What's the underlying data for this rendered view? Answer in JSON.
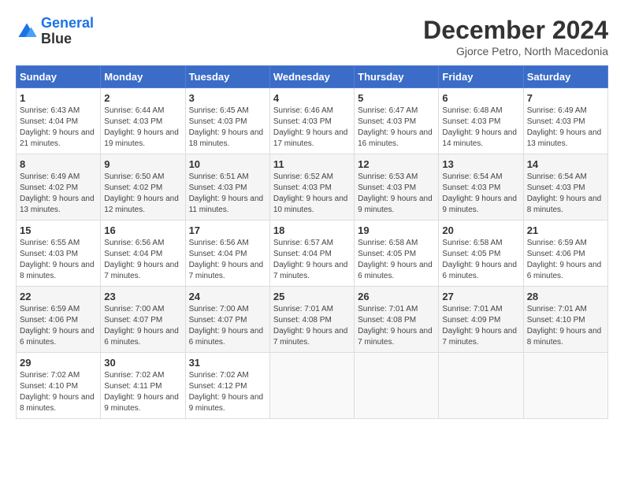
{
  "header": {
    "logo_line1": "General",
    "logo_line2": "Blue",
    "month": "December 2024",
    "location": "Gjorce Petro, North Macedonia"
  },
  "days": [
    "Sunday",
    "Monday",
    "Tuesday",
    "Wednesday",
    "Thursday",
    "Friday",
    "Saturday"
  ],
  "weeks": [
    [
      {
        "num": "1",
        "rise": "6:43 AM",
        "set": "4:04 PM",
        "daylight": "9 hours and 21 minutes."
      },
      {
        "num": "2",
        "rise": "6:44 AM",
        "set": "4:03 PM",
        "daylight": "9 hours and 19 minutes."
      },
      {
        "num": "3",
        "rise": "6:45 AM",
        "set": "4:03 PM",
        "daylight": "9 hours and 18 minutes."
      },
      {
        "num": "4",
        "rise": "6:46 AM",
        "set": "4:03 PM",
        "daylight": "9 hours and 17 minutes."
      },
      {
        "num": "5",
        "rise": "6:47 AM",
        "set": "4:03 PM",
        "daylight": "9 hours and 16 minutes."
      },
      {
        "num": "6",
        "rise": "6:48 AM",
        "set": "4:03 PM",
        "daylight": "9 hours and 14 minutes."
      },
      {
        "num": "7",
        "rise": "6:49 AM",
        "set": "4:03 PM",
        "daylight": "9 hours and 13 minutes."
      }
    ],
    [
      {
        "num": "8",
        "rise": "6:49 AM",
        "set": "4:02 PM",
        "daylight": "9 hours and 13 minutes."
      },
      {
        "num": "9",
        "rise": "6:50 AM",
        "set": "4:02 PM",
        "daylight": "9 hours and 12 minutes."
      },
      {
        "num": "10",
        "rise": "6:51 AM",
        "set": "4:03 PM",
        "daylight": "9 hours and 11 minutes."
      },
      {
        "num": "11",
        "rise": "6:52 AM",
        "set": "4:03 PM",
        "daylight": "9 hours and 10 minutes."
      },
      {
        "num": "12",
        "rise": "6:53 AM",
        "set": "4:03 PM",
        "daylight": "9 hours and 9 minutes."
      },
      {
        "num": "13",
        "rise": "6:54 AM",
        "set": "4:03 PM",
        "daylight": "9 hours and 9 minutes."
      },
      {
        "num": "14",
        "rise": "6:54 AM",
        "set": "4:03 PM",
        "daylight": "9 hours and 8 minutes."
      }
    ],
    [
      {
        "num": "15",
        "rise": "6:55 AM",
        "set": "4:03 PM",
        "daylight": "9 hours and 8 minutes."
      },
      {
        "num": "16",
        "rise": "6:56 AM",
        "set": "4:04 PM",
        "daylight": "9 hours and 7 minutes."
      },
      {
        "num": "17",
        "rise": "6:56 AM",
        "set": "4:04 PM",
        "daylight": "9 hours and 7 minutes."
      },
      {
        "num": "18",
        "rise": "6:57 AM",
        "set": "4:04 PM",
        "daylight": "9 hours and 7 minutes."
      },
      {
        "num": "19",
        "rise": "6:58 AM",
        "set": "4:05 PM",
        "daylight": "9 hours and 6 minutes."
      },
      {
        "num": "20",
        "rise": "6:58 AM",
        "set": "4:05 PM",
        "daylight": "9 hours and 6 minutes."
      },
      {
        "num": "21",
        "rise": "6:59 AM",
        "set": "4:06 PM",
        "daylight": "9 hours and 6 minutes."
      }
    ],
    [
      {
        "num": "22",
        "rise": "6:59 AM",
        "set": "4:06 PM",
        "daylight": "9 hours and 6 minutes."
      },
      {
        "num": "23",
        "rise": "7:00 AM",
        "set": "4:07 PM",
        "daylight": "9 hours and 6 minutes."
      },
      {
        "num": "24",
        "rise": "7:00 AM",
        "set": "4:07 PM",
        "daylight": "9 hours and 6 minutes."
      },
      {
        "num": "25",
        "rise": "7:01 AM",
        "set": "4:08 PM",
        "daylight": "9 hours and 7 minutes."
      },
      {
        "num": "26",
        "rise": "7:01 AM",
        "set": "4:08 PM",
        "daylight": "9 hours and 7 minutes."
      },
      {
        "num": "27",
        "rise": "7:01 AM",
        "set": "4:09 PM",
        "daylight": "9 hours and 7 minutes."
      },
      {
        "num": "28",
        "rise": "7:01 AM",
        "set": "4:10 PM",
        "daylight": "9 hours and 8 minutes."
      }
    ],
    [
      {
        "num": "29",
        "rise": "7:02 AM",
        "set": "4:10 PM",
        "daylight": "9 hours and 8 minutes."
      },
      {
        "num": "30",
        "rise": "7:02 AM",
        "set": "4:11 PM",
        "daylight": "9 hours and 9 minutes."
      },
      {
        "num": "31",
        "rise": "7:02 AM",
        "set": "4:12 PM",
        "daylight": "9 hours and 9 minutes."
      },
      null,
      null,
      null,
      null
    ]
  ]
}
